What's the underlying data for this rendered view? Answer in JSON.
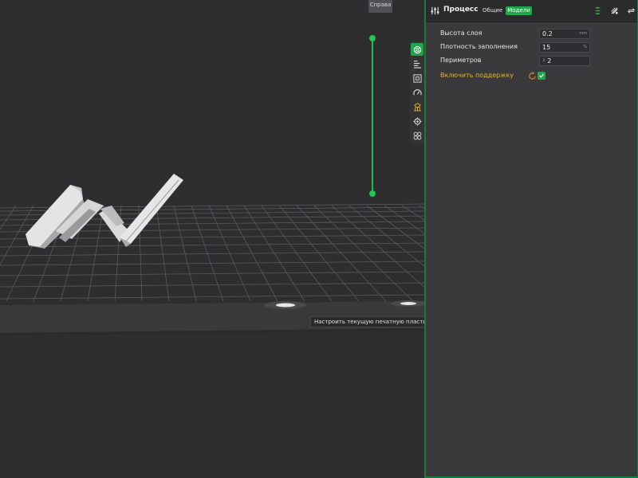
{
  "viewport": {
    "view_label": "Справа",
    "tooltip": "Настроить текущую печатную пластину",
    "toolbar_icons": [
      "quality-icon",
      "strength-icon",
      "speed-icon",
      "support-icon",
      "others-icon",
      "multimaterial-icon",
      "fan-icon"
    ]
  },
  "panel": {
    "title": "Процесс",
    "tabs": [
      {
        "label": "Общие",
        "active": false
      },
      {
        "label": "Модели",
        "active": true
      }
    ],
    "params": {
      "layer_height": {
        "label": "Высота слоя",
        "value": "0.2",
        "unit": "mm"
      },
      "infill_density": {
        "label": "Плотность заполнения",
        "value": "15",
        "unit": "%"
      },
      "perimeters": {
        "label": "Периметров",
        "value": "2"
      },
      "enable_support": {
        "label": "Включить поддержку",
        "checked": true
      }
    }
  },
  "colors": {
    "accent_green": "#1fa84a",
    "warning_label": "#e8b12c",
    "viewport_bg": "#2e2e31",
    "panel_bg": "#3a3a3d"
  }
}
